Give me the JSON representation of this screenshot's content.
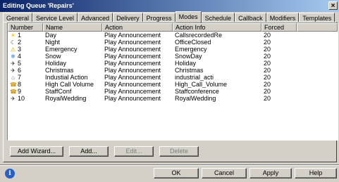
{
  "window": {
    "title": "Editing Queue 'Repairs'",
    "close_glyph": "×"
  },
  "tabs": [
    {
      "label": "General"
    },
    {
      "label": "Service Level"
    },
    {
      "label": "Advanced"
    },
    {
      "label": "Delivery"
    },
    {
      "label": "Progress"
    },
    {
      "label": "Modes"
    },
    {
      "label": "Schedule"
    },
    {
      "label": "Callback"
    },
    {
      "label": "Modifiers"
    },
    {
      "label": "Templates"
    }
  ],
  "active_tab": "Modes",
  "table": {
    "columns": [
      "Number",
      "Name",
      "Action",
      "Action Info",
      "Forced"
    ],
    "rows": [
      {
        "number": "1",
        "icon": "sun-icon",
        "name": "Day",
        "action": "Play Announcement",
        "info": "CallsrecordedRe",
        "forced": "20"
      },
      {
        "number": "2",
        "icon": "night-icon",
        "name": "Night",
        "action": "Play Announcement",
        "info": "OfficeClosed",
        "forced": "20"
      },
      {
        "number": "3",
        "icon": "warning-icon",
        "name": "Emergency",
        "action": "Play Announcement",
        "info": "Emergency",
        "forced": "20"
      },
      {
        "number": "4",
        "icon": "snowflake-icon",
        "name": "Snow",
        "action": "Play Announcement",
        "info": "SnowDay",
        "forced": "20"
      },
      {
        "number": "5",
        "icon": "airplane-icon",
        "name": "Holiday",
        "action": "Play Announcement",
        "info": "Holiday",
        "forced": "20"
      },
      {
        "number": "6",
        "icon": "airplane-icon",
        "name": "Christmas",
        "action": "Play Announcement",
        "info": "Christmas",
        "forced": "20"
      },
      {
        "number": "7",
        "icon": "building-icon",
        "name": "Industial Action",
        "action": "Play Announcement",
        "info": "industrial_acti",
        "forced": "20"
      },
      {
        "number": "8",
        "icon": "phone-volume-icon",
        "name": "High Call Volume",
        "action": "Play Announcement",
        "info": "High_Call_Volume",
        "forced": "20"
      },
      {
        "number": "9",
        "icon": "phone-volume-icon",
        "name": "StaffConf",
        "action": "Play Announcement",
        "info": "Staffconference",
        "forced": "20"
      },
      {
        "number": "10",
        "icon": "airplane-icon",
        "name": "RoyalWedding",
        "action": "Play Announcement",
        "info": "RoyalWedding",
        "forced": "20"
      }
    ]
  },
  "buttons": {
    "add_wizard": "Add Wizard...",
    "add": "Add...",
    "edit": "Edit...",
    "delete": "Delete",
    "ok": "OK",
    "cancel": "Cancel",
    "apply": "Apply",
    "help": "Help"
  },
  "info_glyph": "i"
}
